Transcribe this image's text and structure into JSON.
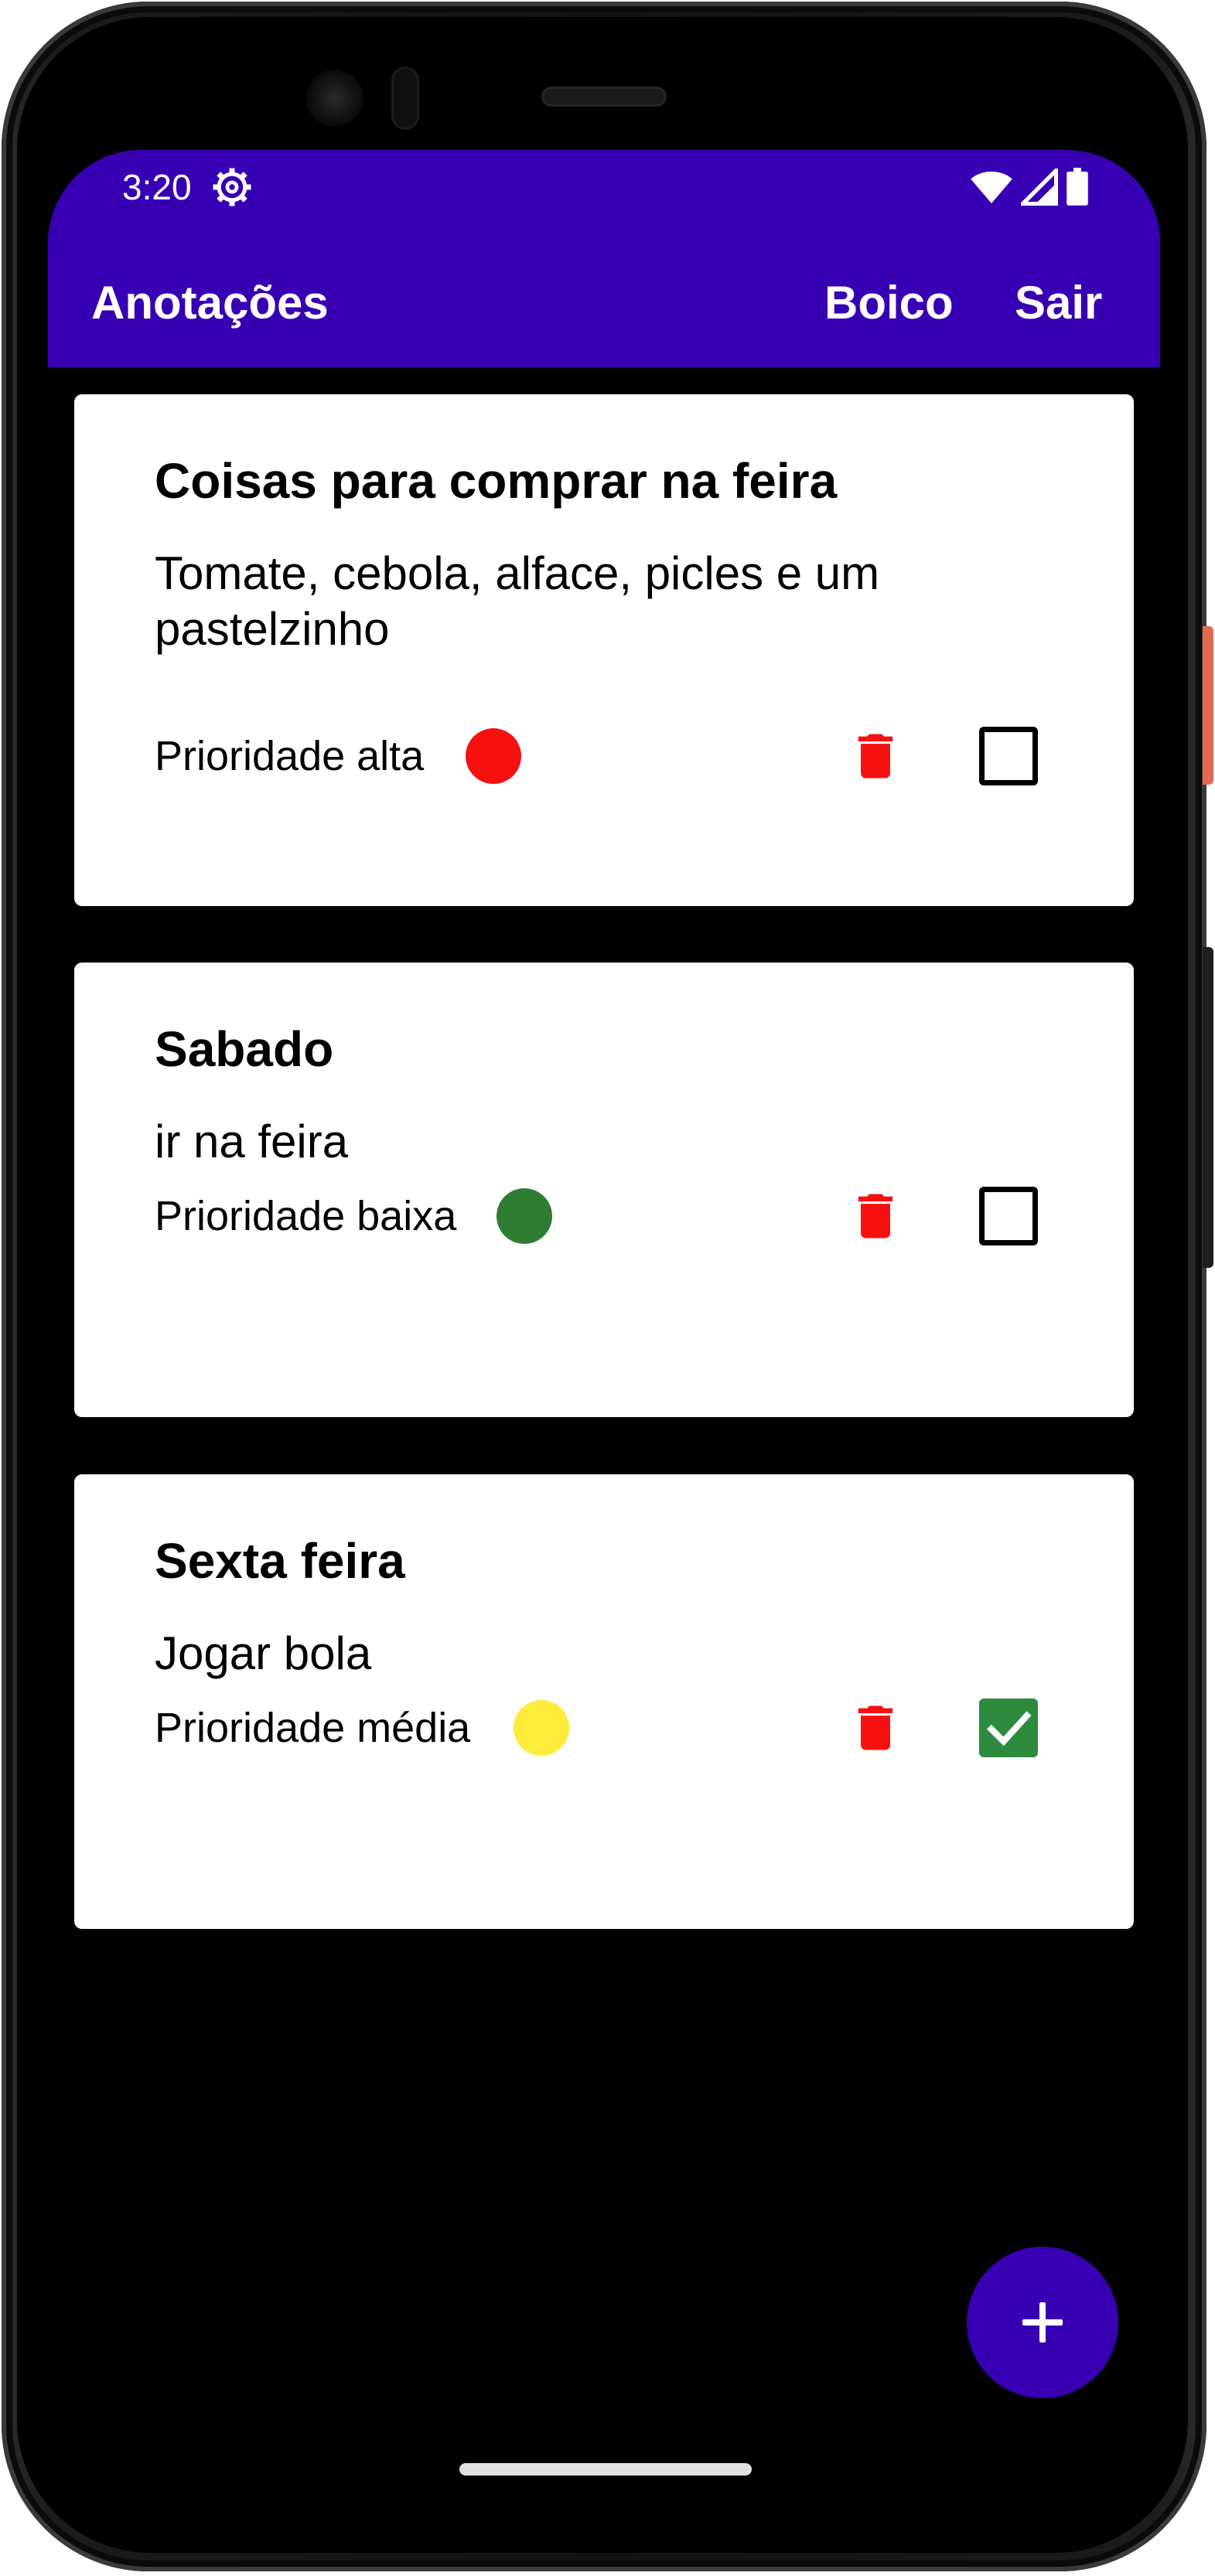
{
  "status_bar": {
    "time": "3:20",
    "icons": [
      "settings-gear-icon",
      "wifi-icon",
      "cell-signal-icon",
      "battery-icon"
    ]
  },
  "app_bar": {
    "title": "Anotações",
    "actions": [
      {
        "label": "Boico"
      },
      {
        "label": "Sair"
      }
    ]
  },
  "notes": [
    {
      "title": "Coisas para comprar na feira",
      "description": "Tomate, cebola, alface, picles e um pastelzinho",
      "priority_label": "Prioridade alta",
      "priority_color": "#f71010",
      "done": false
    },
    {
      "title": "Sabado",
      "description": "ir na feira",
      "priority_label": "Prioridade baixa",
      "priority_color": "#2e7d32",
      "done": false
    },
    {
      "title": "Sexta feira",
      "description": "Jogar bola",
      "priority_label": "Prioridade média",
      "priority_color": "#ffeb3b",
      "done": true
    }
  ],
  "colors": {
    "primary": "#3700b3",
    "trash": "#f71010",
    "check": "#2e8b3e",
    "background": "#000000",
    "card": "#ffffff"
  },
  "fab": {
    "icon": "plus-icon"
  }
}
